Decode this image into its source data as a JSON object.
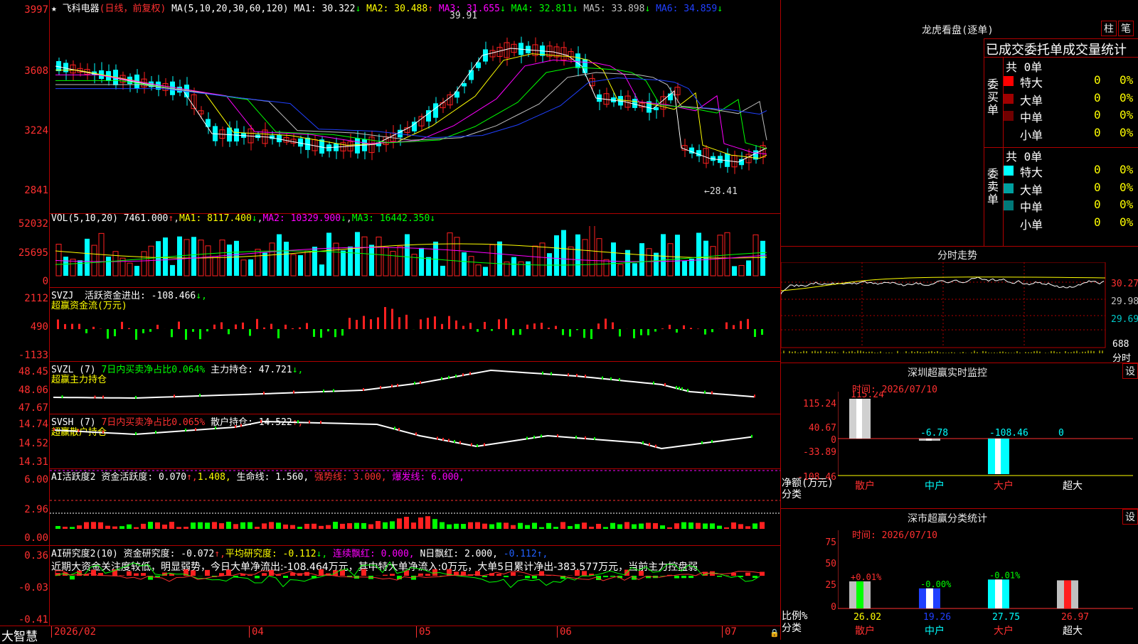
{
  "app": {
    "name": "大智慧"
  },
  "chart_header": {
    "stock": "飞科电器",
    "mode": "(日线，前复权)",
    "ma_label": "MA(5,10,20,30,60,120)",
    "ma": [
      {
        "name": "MA1",
        "value": "30.322",
        "arrow": "↓",
        "color": "#ffffff"
      },
      {
        "name": "MA2",
        "value": "30.488",
        "arrow": "↑",
        "color": "#ffff00"
      },
      {
        "name": "MA3",
        "value": "31.655",
        "arrow": "↓",
        "color": "#ff00ff"
      },
      {
        "name": "MA4",
        "value": "32.811",
        "arrow": "↓",
        "color": "#00ff00"
      },
      {
        "name": "MA5",
        "value": "33.898",
        "arrow": "↓",
        "color": "#c0c0c0"
      },
      {
        "name": "MA6",
        "value": "34.859",
        "arrow": "↓",
        "color": "#2040ff"
      }
    ]
  },
  "price_axis": [
    "3997",
    "3608",
    "3224",
    "2841"
  ],
  "price_marks": {
    "high": "39.91",
    "low": "←28.41"
  },
  "vol_header": {
    "label": "VOL(5,10,20)",
    "value": "7461.000",
    "ma1": "8117.400",
    "ma2": "10329.900",
    "ma3": "16442.350"
  },
  "vol_axis": [
    "52032",
    "25695",
    "0"
  ],
  "svzj": {
    "label": "SVZJ",
    "title": "活跃资金进出: -108.466",
    "arrow": "↓,",
    "subtitle": "超赢资金流(万元)",
    "axis": [
      "2112",
      "490",
      "-1133"
    ]
  },
  "svzl": {
    "label": "SVZL (7)",
    "ratio": "7日内买卖净占比0.064%",
    "main": "主力持仓: 47.721",
    "arrow": "↓,",
    "subtitle": "超赢主力持仓",
    "axis": [
      "48.45",
      "48.06",
      "47.67"
    ]
  },
  "svsh": {
    "label": "SVSH (7)",
    "ratio": "7日内买卖净占比0.065%",
    "retail": "散户持仓: 14.522",
    "arrow": "↑,",
    "subtitle": "超赢散户持仓",
    "axis": [
      "14.74",
      "14.52",
      "14.31"
    ]
  },
  "ai_active": {
    "label": "AI活跃度2",
    "fund": "资金活跃度: 0.070",
    "arrow": "↑,",
    "v2": "1.408,",
    "life": "生命线: 1.560,",
    "strong": "强势线: 3.000,",
    "burst": "爆发线: 6.000,",
    "axis": [
      "6.00",
      "2.96",
      "0.00"
    ]
  },
  "ai_research": {
    "label": "AI研究度2(10)",
    "fund": "资金研究度: -0.072",
    "arrow": "↑,",
    "avg": "平均研究度: -0.112",
    "arrow2": "↓,",
    "red": "连续飘红: 0.000,",
    "nred": "N日飘红: 2.000,",
    "last": "-0.112↑,",
    "comment": "近期大资金关注度较低，明显弱势，今日大单净流出:-108.464万元，其中特大单净流入:0万元，大单5日累计净出-383.577万元，当前主力控盘弱",
    "axis": [
      "0.36",
      "-0.03",
      "-0.41"
    ]
  },
  "date_axis": [
    "2026/02",
    "04",
    "05",
    "06",
    "07"
  ],
  "right": {
    "longhu_title": "龙虎看盘(逐单)",
    "btn_zhu": "柱",
    "btn_bi": "笔",
    "stats_title": "已成交委托单成交量统计",
    "buy_group": "委买单",
    "sell_group": "委卖单",
    "buy_total": "共 0单",
    "sell_total": "共 0单",
    "buy_rows": [
      {
        "label": "特大",
        "count": "0",
        "pct": "0%",
        "color": "#ff0000"
      },
      {
        "label": "大单",
        "count": "0",
        "pct": "0%",
        "color": "#a00000"
      },
      {
        "label": "中单",
        "count": "0",
        "pct": "0%",
        "color": "#700000"
      },
      {
        "label": "小单",
        "count": "0",
        "pct": "0%",
        "color": ""
      }
    ],
    "sell_rows": [
      {
        "label": "特大",
        "count": "0",
        "pct": "0%",
        "color": "#00ffff"
      },
      {
        "label": "大单",
        "count": "0",
        "pct": "0%",
        "color": "#00a0a0"
      },
      {
        "label": "中单",
        "count": "0",
        "pct": "0%",
        "color": "#007878"
      },
      {
        "label": "小单",
        "count": "0",
        "pct": "0%",
        "color": ""
      }
    ],
    "intraday_title": "分时走势",
    "intraday_axis": [
      "30.27",
      "29.98",
      "29.69",
      "688",
      "分时"
    ],
    "monitor_title": "深圳超赢实时监控",
    "set_label": "设",
    "monitor_time": "时间: 2026/07/10",
    "monitor_axis": [
      "115.24",
      "40.67",
      "0",
      "-33.89",
      "-108.46"
    ],
    "monitor_net_label": "净额(万元)",
    "monitor_cat_label": "分类",
    "monitor_values": [
      "115.24",
      "-6.78",
      "-108.46",
      "0"
    ],
    "categories": [
      "散户",
      "中户",
      "大户",
      "超大"
    ],
    "class_title": "深市超赢分类统计",
    "class_time": "时间: 2026/07/10",
    "class_axis": [
      "75",
      "50",
      "25",
      "0"
    ],
    "class_top": [
      "+0.01%",
      "-0.00%",
      "-0.01%",
      ""
    ],
    "class_bottom": [
      "26.02",
      "19.26",
      "27.75",
      "26.97"
    ],
    "class_ratio_label": "比例%",
    "class_cat_label": "分类"
  }
}
